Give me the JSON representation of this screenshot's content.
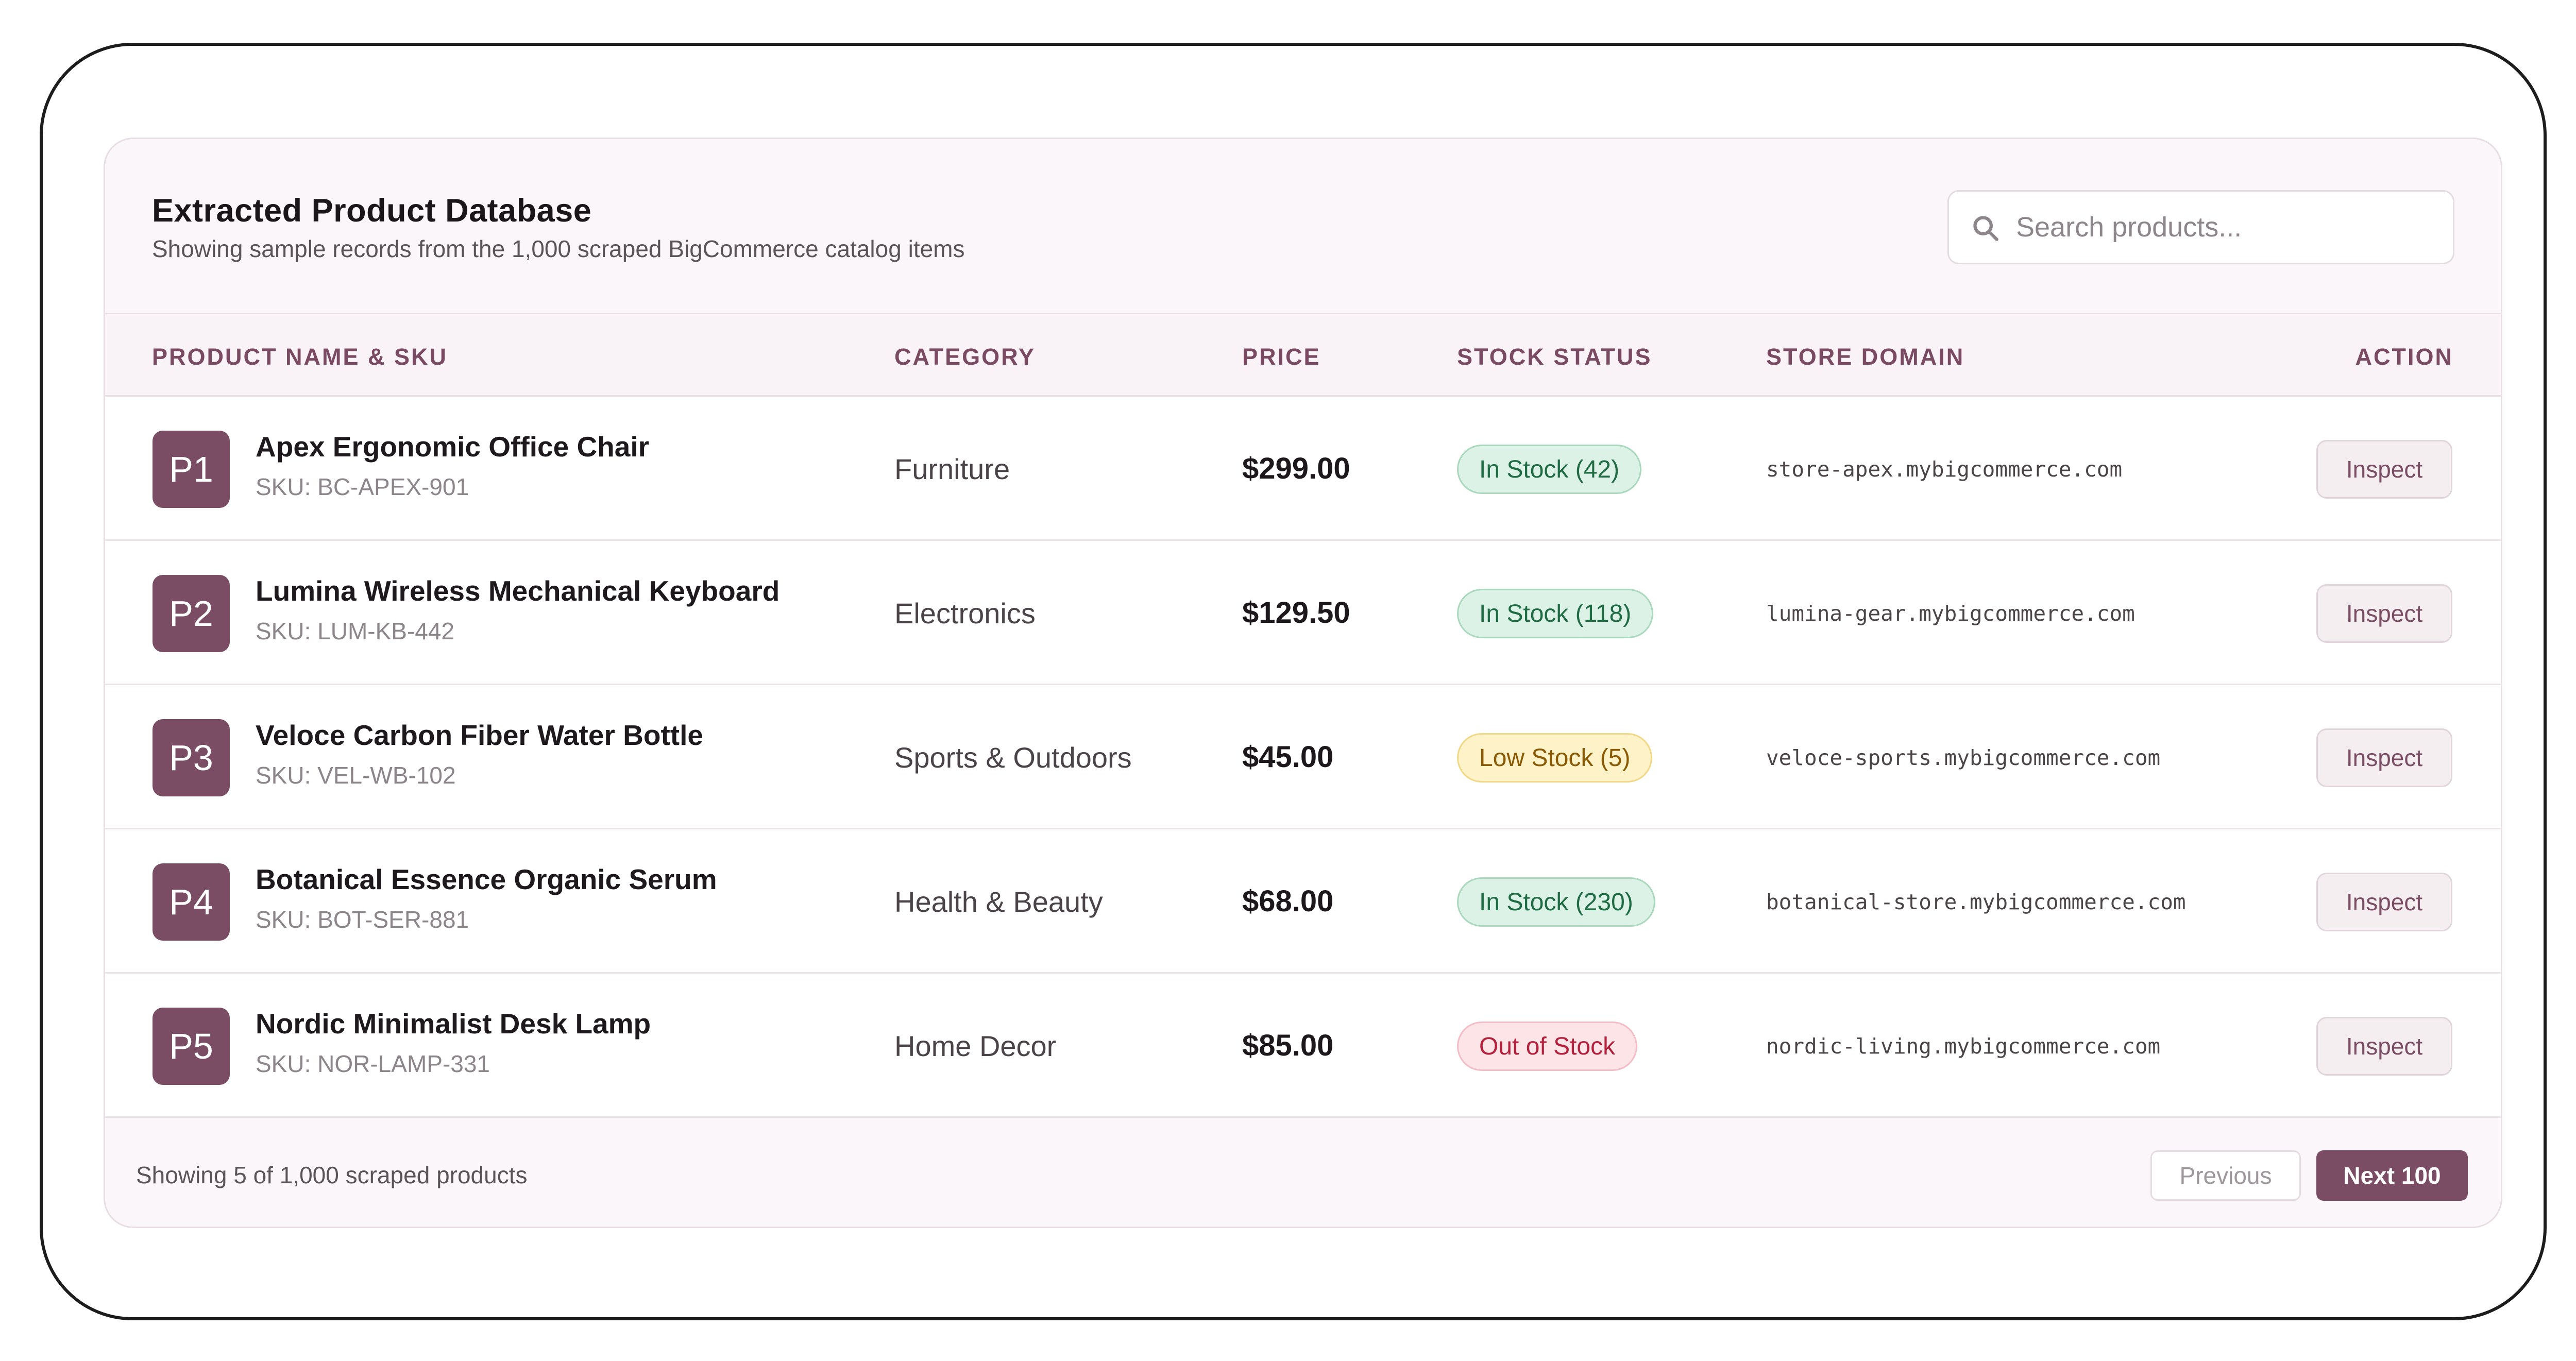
{
  "header": {
    "title": "Extracted Product Database",
    "subtitle": "Showing sample records from the 1,000 scraped BigCommerce catalog items",
    "search_placeholder": "Search products..."
  },
  "table": {
    "columns": {
      "product": "PRODUCT NAME & SKU",
      "category": "CATEGORY",
      "price": "PRICE",
      "stock": "STOCK STATUS",
      "domain": "STORE DOMAIN",
      "action": "ACTION"
    },
    "rows": [
      {
        "badge": "P1",
        "name": "Apex Ergonomic Office Chair",
        "sku": "SKU: BC-APEX-901",
        "category": "Furniture",
        "price": "$299.00",
        "stock": "In Stock (42)",
        "stock_state": "in",
        "domain": "store-apex.mybigcommerce.com",
        "action": "Inspect"
      },
      {
        "badge": "P2",
        "name": "Lumina Wireless Mechanical Keyboard",
        "sku": "SKU: LUM-KB-442",
        "category": "Electronics",
        "price": "$129.50",
        "stock": "In Stock (118)",
        "stock_state": "in",
        "domain": "lumina-gear.mybigcommerce.com",
        "action": "Inspect"
      },
      {
        "badge": "P3",
        "name": "Veloce Carbon Fiber Water Bottle",
        "sku": "SKU: VEL-WB-102",
        "category": "Sports & Outdoors",
        "price": "$45.00",
        "stock": "Low Stock (5)",
        "stock_state": "low",
        "domain": "veloce-sports.mybigcommerce.com",
        "action": "Inspect"
      },
      {
        "badge": "P4",
        "name": "Botanical Essence Organic Serum",
        "sku": "SKU: BOT-SER-881",
        "category": "Health & Beauty",
        "price": "$68.00",
        "stock": "In Stock (230)",
        "stock_state": "in",
        "domain": "botanical-store.mybigcommerce.com",
        "action": "Inspect"
      },
      {
        "badge": "P5",
        "name": "Nordic Minimalist Desk Lamp",
        "sku": "SKU: NOR-LAMP-331",
        "category": "Home Decor",
        "price": "$85.00",
        "stock": "Out of Stock",
        "stock_state": "out",
        "domain": "nordic-living.mybigcommerce.com",
        "action": "Inspect"
      }
    ]
  },
  "footer": {
    "summary": "Showing 5 of 1,000 scraped products",
    "previous_label": "Previous",
    "next_label": "Next 100"
  },
  "colors": {
    "accent": "#7b4d64",
    "in_stock": "#1f6b43",
    "low_stock": "#8a5a05",
    "out_of_stock": "#b3213c"
  }
}
